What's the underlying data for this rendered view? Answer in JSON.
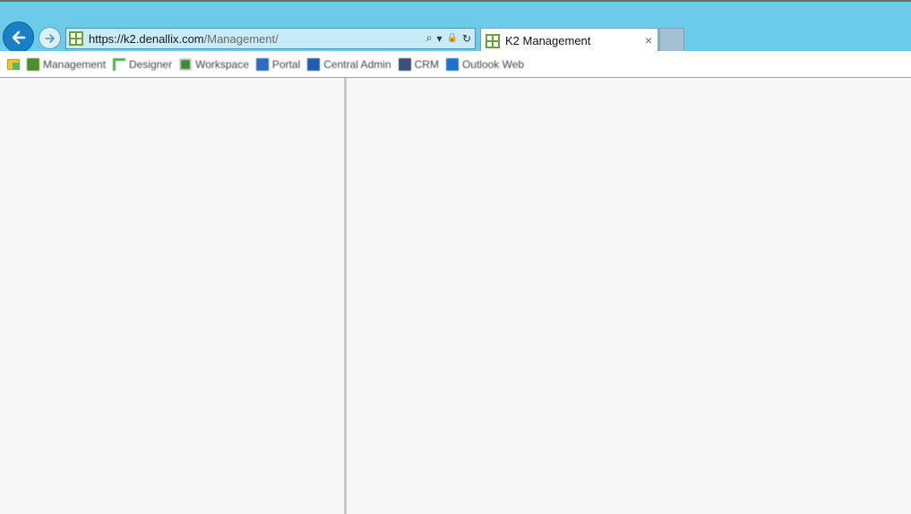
{
  "browser": {
    "address": {
      "protocol": "https://",
      "host": "k2.denallix.com",
      "path": "/Management/"
    },
    "tab": {
      "title": "K2 Management",
      "close_glyph": "×"
    },
    "address_controls": {
      "search": "⌕",
      "dropdown": "▾",
      "lock": "🔒",
      "refresh": "↻"
    }
  },
  "favorites": [
    {
      "label": "Management",
      "icon": "grid-icon"
    },
    {
      "label": "Designer",
      "icon": "designer-icon"
    },
    {
      "label": "Workspace",
      "icon": "workspace-icon"
    },
    {
      "label": "Portal",
      "icon": "portal-icon"
    },
    {
      "label": "Central Admin",
      "icon": "central-admin-icon"
    },
    {
      "label": "CRM",
      "icon": "crm-icon"
    },
    {
      "label": "Outlook Web",
      "icon": "outlook-icon"
    }
  ],
  "colors": {
    "chrome": "#6bcbe8",
    "back_button": "#1a7fc4",
    "content_bg": "#f7f7f7",
    "site_icon": "#6ba33a"
  }
}
